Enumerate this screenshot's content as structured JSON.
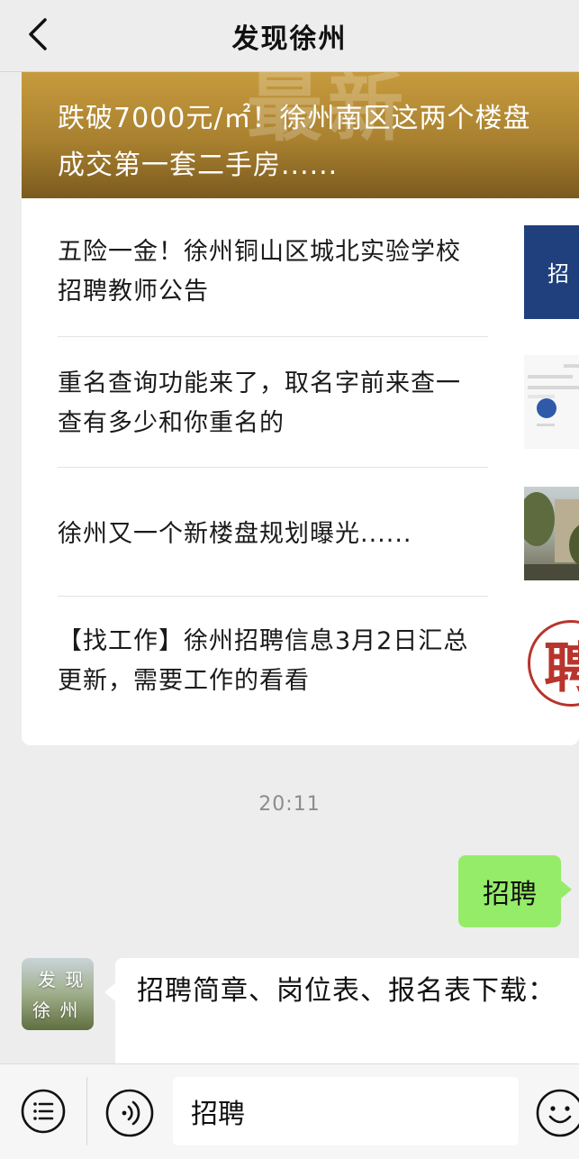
{
  "header": {
    "title": "发现徐州",
    "back_icon": "chevron-left-icon"
  },
  "articles_card": {
    "banner": {
      "watermark": "最新",
      "title": "跌破7000元/㎡！徐州南区这两个楼盘\n成交第一套二手房......"
    },
    "articles": [
      {
        "title": "五险一金！徐州铜山区城北实验学校招聘教师公告",
        "thumb_text": "招 聘"
      },
      {
        "title": "重名查询功能来了，取名字前来查一查有多少和你重名的"
      },
      {
        "title": "徐州又一个新楼盘规划曝光......"
      },
      {
        "title": "【找工作】徐州招聘信息3月2日汇总更新，需要工作的看看",
        "thumb_text": "聘"
      }
    ]
  },
  "chat": {
    "timestamp": "20:11",
    "outgoing_message": "招聘",
    "incoming": {
      "avatar_text_top": "发 现",
      "avatar_text_bottom": "徐 州",
      "message": "招聘简章、岗位表、报名表下载："
    }
  },
  "input_bar": {
    "value": "招聘",
    "menu_icon": "menu-list-icon",
    "voice_icon": "voice-icon",
    "emoji_icon": "emoji-icon"
  },
  "colors": {
    "background": "#ededed",
    "bubble_out": "#95ec69",
    "banner_gold": "#a8802f",
    "thumb_blue": "#1f3f7d",
    "seal_red": "#b8342c"
  }
}
